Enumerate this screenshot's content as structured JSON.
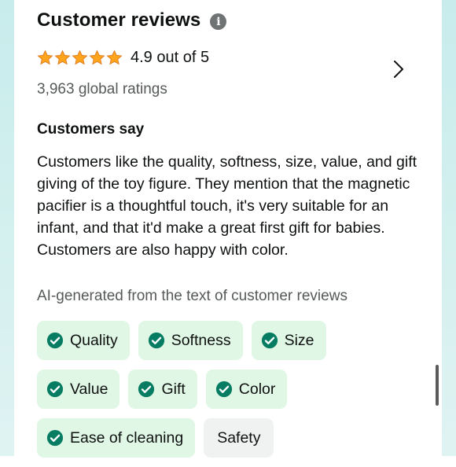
{
  "header": {
    "title": "Customer reviews",
    "info_icon": "info-icon"
  },
  "rating": {
    "stars_filled": 5,
    "stars_total": 5,
    "text": "4.9 out of 5",
    "star_color": "#ffa41c",
    "ratings_count": "3,963 global ratings"
  },
  "customers_say": {
    "heading": "Customers say",
    "summary": "Customers like the quality, softness, size, value, and gift giving of the toy figure. They mention that the magnetic pacifier is a thoughtful touch, it's very suitable for an infant, and that it'd make a great first gift for babies. Customers are also happy with color.",
    "ai_note": "AI-generated from the text of customer reviews"
  },
  "aspects": [
    {
      "label": "Quality",
      "positive": true
    },
    {
      "label": "Softness",
      "positive": true
    },
    {
      "label": "Size",
      "positive": true
    },
    {
      "label": "Value",
      "positive": true
    },
    {
      "label": "Gift",
      "positive": true
    },
    {
      "label": "Color",
      "positive": true
    },
    {
      "label": "Ease of cleaning",
      "positive": true
    },
    {
      "label": "Safety",
      "positive": false
    }
  ],
  "colors": {
    "positive_chip_bg": "#dff7e4",
    "neutral_chip_bg": "#f0f2f2",
    "check_color": "#067d62"
  }
}
